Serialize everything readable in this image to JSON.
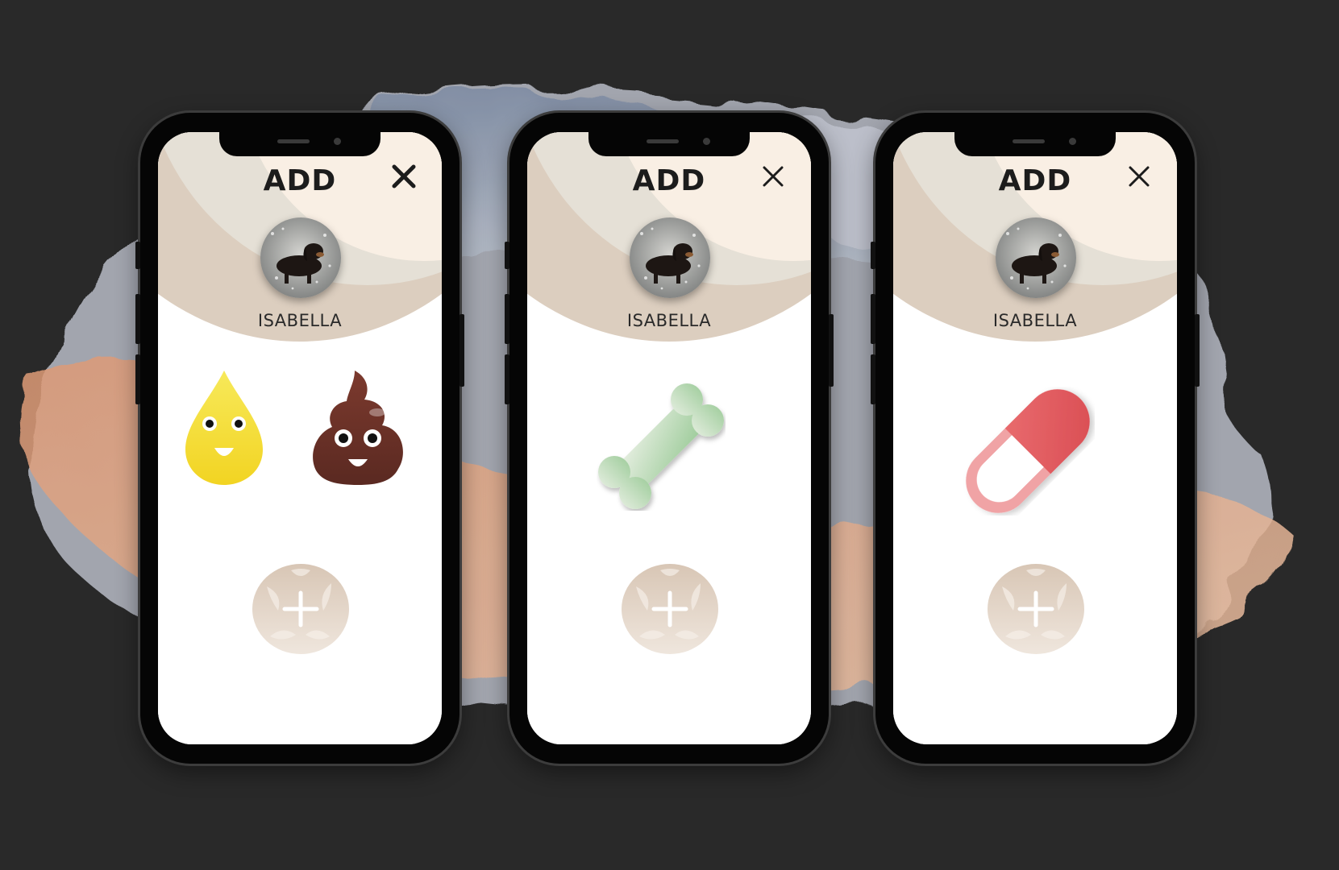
{
  "colors": {
    "background": "#292929",
    "header_cream": "#f9efe4",
    "header_beige": "#e5e0d6",
    "header_tan": "#dccebf",
    "drop_yellow": "#f6e239",
    "poop_brown": "#6a3026",
    "bone_green": "#a8d0a4",
    "pill_red": "#e2555a",
    "add_button": "#e2d4c7"
  },
  "screens": [
    {
      "title": "ADD",
      "pet_name": "ISABELLA",
      "items": [
        {
          "label_icon": "pee-drop-icon"
        },
        {
          "label_icon": "poop-icon"
        }
      ],
      "close_icon": "close-icon",
      "add_icon": "plus-icon"
    },
    {
      "title": "ADD",
      "pet_name": "ISABELLA",
      "items": [
        {
          "label_icon": "bone-icon"
        }
      ],
      "close_icon": "close-icon",
      "add_icon": "plus-icon"
    },
    {
      "title": "ADD",
      "pet_name": "ISABELLA",
      "items": [
        {
          "label_icon": "pill-icon"
        }
      ],
      "close_icon": "close-icon",
      "add_icon": "plus-icon"
    }
  ]
}
